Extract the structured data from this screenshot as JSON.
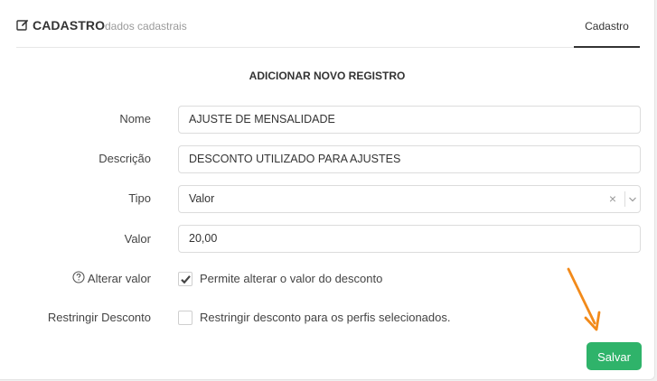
{
  "header": {
    "title": "CADASTRO",
    "subtitle": "dados cadastrais",
    "tab_label": "Cadastro"
  },
  "form": {
    "title": "ADICIONAR NOVO REGISTRO",
    "fields": {
      "nome": {
        "label": "Nome",
        "value": "AJUSTE DE MENSALIDADE"
      },
      "descricao": {
        "label": "Descrição",
        "value": "DESCONTO UTILIZADO PARA AJUSTES"
      },
      "tipo": {
        "label": "Tipo",
        "value": "Valor"
      },
      "valor": {
        "label": "Valor",
        "value": "20,00"
      }
    },
    "alterar_valor": {
      "label": "Alterar valor",
      "checkbox_label": "Permite alterar o valor do desconto",
      "checked": true
    },
    "restringir_desconto": {
      "label": "Restringir Desconto",
      "checkbox_label": "Restringir desconto para os perfis selecionados.",
      "checked": false
    },
    "save_label": "Salvar"
  },
  "colors": {
    "accent": "#2fb36a",
    "annotation_arrow": "#f28a1a"
  },
  "icons": {
    "header": "edit-icon",
    "help": "help-circle-icon",
    "select_clear": "clear-icon",
    "select_toggle": "chevron-down-icon"
  }
}
